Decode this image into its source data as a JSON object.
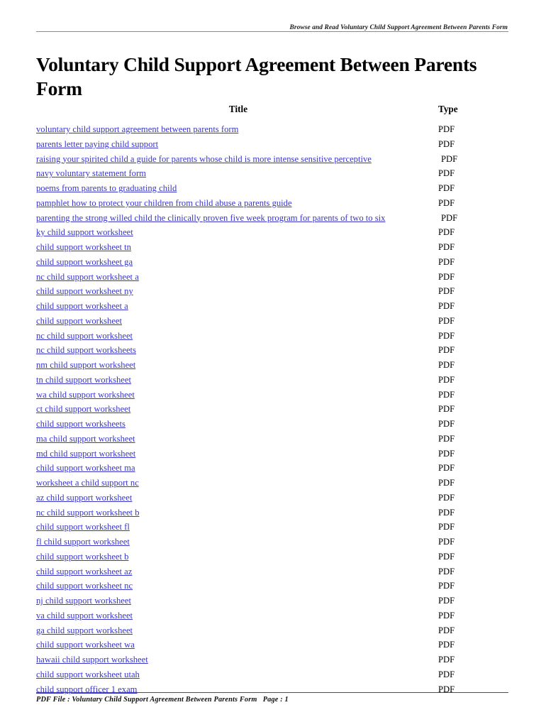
{
  "header": {
    "running_head": "Browse and Read Voluntary Child Support Agreement Between Parents Form"
  },
  "document": {
    "title": "Voluntary Child Support Agreement Between Parents Form"
  },
  "table": {
    "columns": {
      "title": "Title",
      "type": "Type"
    },
    "rows": [
      {
        "title": "voluntary child support agreement between parents form",
        "type": "PDF"
      },
      {
        "title": "parents letter paying child support",
        "type": "PDF"
      },
      {
        "title": "raising your spirited child a guide for parents whose child is more intense sensitive perceptive",
        "type": "PDF"
      },
      {
        "title": "navy voluntary statement form",
        "type": "PDF"
      },
      {
        "title": "poems from parents to graduating child",
        "type": "PDF"
      },
      {
        "title": "pamphlet how to protect your children from child abuse a parents guide",
        "type": "PDF"
      },
      {
        "title": "parenting the strong willed child the clinically proven five week program for parents of two to six",
        "type": "PDF"
      },
      {
        "title": "ky child support worksheet",
        "type": "PDF"
      },
      {
        "title": "child support worksheet tn",
        "type": "PDF"
      },
      {
        "title": "child support worksheet ga",
        "type": "PDF"
      },
      {
        "title": "nc child support worksheet a",
        "type": "PDF"
      },
      {
        "title": "child support worksheet ny",
        "type": "PDF"
      },
      {
        "title": "child support worksheet a",
        "type": "PDF"
      },
      {
        "title": "child support worksheet",
        "type": "PDF"
      },
      {
        "title": "nc child support worksheet",
        "type": "PDF"
      },
      {
        "title": "nc child support worksheets",
        "type": "PDF"
      },
      {
        "title": "nm child support worksheet",
        "type": "PDF"
      },
      {
        "title": "tn child support worksheet",
        "type": "PDF"
      },
      {
        "title": "wa child support worksheet",
        "type": "PDF"
      },
      {
        "title": "ct child support worksheet",
        "type": "PDF"
      },
      {
        "title": "child support worksheets",
        "type": "PDF"
      },
      {
        "title": "ma child support worksheet",
        "type": "PDF"
      },
      {
        "title": "md child support worksheet",
        "type": "PDF"
      },
      {
        "title": "child support worksheet ma",
        "type": "PDF"
      },
      {
        "title": "worksheet a child support nc",
        "type": "PDF"
      },
      {
        "title": "az child support worksheet",
        "type": "PDF"
      },
      {
        "title": "nc child support worksheet b",
        "type": "PDF"
      },
      {
        "title": "child support worksheet fl",
        "type": "PDF"
      },
      {
        "title": "fl child support worksheet",
        "type": "PDF"
      },
      {
        "title": "child support worksheet b",
        "type": "PDF"
      },
      {
        "title": "child support worksheet az",
        "type": "PDF"
      },
      {
        "title": "child support worksheet nc",
        "type": "PDF"
      },
      {
        "title": "nj child support worksheet",
        "type": "PDF"
      },
      {
        "title": "va child support worksheet",
        "type": "PDF"
      },
      {
        "title": "ga child support worksheet",
        "type": "PDF"
      },
      {
        "title": "child support worksheet wa",
        "type": "PDF"
      },
      {
        "title": "hawaii child support worksheet",
        "type": "PDF"
      },
      {
        "title": "child support worksheet utah",
        "type": "PDF"
      },
      {
        "title": "child support officer 1 exam",
        "type": "PDF"
      }
    ]
  },
  "footer": {
    "text": "PDF File : Voluntary Child Support Agreement Between Parents Form   Page : 1"
  },
  "colors": {
    "link": "#3836cb",
    "text": "#000000",
    "rule": "#8a8a8a"
  }
}
